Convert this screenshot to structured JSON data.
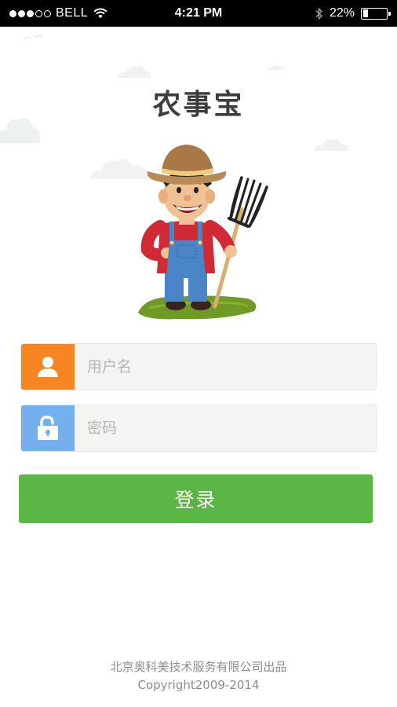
{
  "status_bar": {
    "carrier": "BELL",
    "time": "4:21 PM",
    "battery_percent": "22%",
    "battery_level": 0.22,
    "signal_strength": 3,
    "signal_max": 5
  },
  "app": {
    "title": "农事宝"
  },
  "login_form": {
    "username_placeholder": "用户名",
    "username_value": "",
    "password_placeholder": "密码",
    "password_value": "",
    "login_label": "登录"
  },
  "footer": {
    "company": "北京奥科美技术服务有限公司出品",
    "copyright": "Copyright2009-2014"
  },
  "icons": {
    "user": "user-icon",
    "lock": "unlock-icon",
    "wifi": "wifi-icon",
    "bluetooth": "bluetooth-icon",
    "battery": "battery-icon"
  },
  "colors": {
    "brand_green": "#5cb646",
    "username_icon_bg": "#f98422",
    "password_icon_bg": "#74b0ef",
    "field_bg": "#f4f4f2",
    "title_color": "#3d3d3d",
    "footer_text": "#8f8f8f"
  }
}
